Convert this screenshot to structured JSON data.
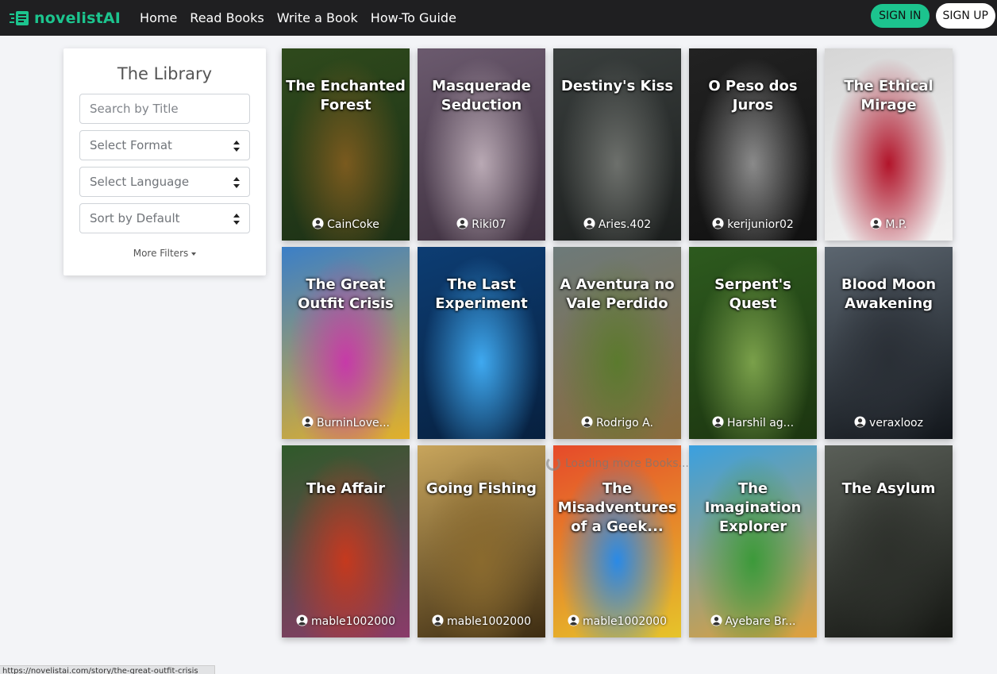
{
  "brand": {
    "name": "novelistAI",
    "accent": "#1cc48e"
  },
  "nav": {
    "links": [
      "Home",
      "Read Books",
      "Write a Book",
      "How-To Guide"
    ],
    "signin": "SIGN IN",
    "signup": "SIGN UP"
  },
  "sidebar": {
    "title": "The Library",
    "search_placeholder": "Search by Title",
    "format": "Select Format",
    "language": "Select Language",
    "sort": "Sort by Default",
    "more_filters": "More Filters"
  },
  "loading_text": "Loading more Books...",
  "status_url": "https://novelistai.com/story/the-great-outfit-crisis",
  "books": [
    {
      "title": "The Enchanted Forest",
      "author": "CainCoke",
      "colors": [
        "#2f4a1c",
        "#7a5a1e",
        "#1c3016"
      ]
    },
    {
      "title": "Masquerade Seduction",
      "author": "Riki07",
      "colors": [
        "#6b5a6e",
        "#b9a9b4",
        "#3d2f3e"
      ]
    },
    {
      "title": "Destiny's Kiss",
      "author": "Aries.402",
      "colors": [
        "#3a3f3e",
        "#6d706c",
        "#1b1e1d"
      ]
    },
    {
      "title": "O Peso dos Juros",
      "author": "kerijunior02",
      "colors": [
        "#222222",
        "#8a8a8a",
        "#111111"
      ]
    },
    {
      "title": "The Ethical Mirage",
      "author": "M.P.",
      "colors": [
        "#d6d6d6",
        "#b2142a",
        "#f3f3f3"
      ]
    },
    {
      "title": "The Great Outfit Crisis",
      "author": "BurninLove...",
      "colors": [
        "#3b7fc7",
        "#c63aa8",
        "#e2b02a"
      ]
    },
    {
      "title": "The Last Experiment",
      "author": "",
      "colors": [
        "#0d3d73",
        "#3fa9f0",
        "#07203f"
      ]
    },
    {
      "title": "A Aventura no Vale Perdido",
      "author": "Rodrigo A.",
      "colors": [
        "#6d7a7a",
        "#5b7a2e",
        "#8a6b3c"
      ]
    },
    {
      "title": "Serpent's Quest",
      "author": "Harshil ag...",
      "colors": [
        "#2d5a1e",
        "#7aa04a",
        "#1c3510"
      ]
    },
    {
      "title": "Blood Moon Awakening",
      "author": "veraxlooz",
      "colors": [
        "#5c6670",
        "#2a2f36",
        "#12161b"
      ]
    },
    {
      "title": "The Affair",
      "author": "mable1002000",
      "colors": [
        "#2f5a2a",
        "#c5391e",
        "#8a3b6a"
      ]
    },
    {
      "title": "Going Fishing",
      "author": "mable1002000",
      "colors": [
        "#c8a55c",
        "#8a6a2e",
        "#3d2c12"
      ]
    },
    {
      "title": "The Misadventures of a Geek...",
      "author": "mable1002000",
      "colors": [
        "#e64a2a",
        "#2a8ae6",
        "#e6c42a"
      ]
    },
    {
      "title": "The Imagination Explorer",
      "author": "Ayebare Br...",
      "colors": [
        "#3aa0e0",
        "#3c9a3a",
        "#e0a03a"
      ]
    },
    {
      "title": "The Asylum",
      "author": "",
      "colors": [
        "#5a5f58",
        "#2d302b",
        "#151713"
      ]
    }
  ]
}
